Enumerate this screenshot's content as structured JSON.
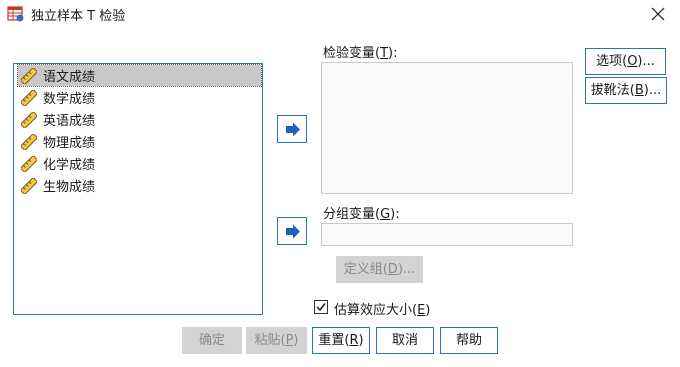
{
  "window": {
    "title": "独立样本 T 检验",
    "icons": {
      "app": "spss-dialog-icon",
      "close": "close-icon"
    }
  },
  "variables": [
    {
      "label": "语文成绩",
      "icon": "scale-ruler-icon",
      "selected": true
    },
    {
      "label": "数学成绩",
      "icon": "scale-ruler-icon",
      "selected": false
    },
    {
      "label": "英语成绩",
      "icon": "scale-ruler-icon",
      "selected": false
    },
    {
      "label": "物理成绩",
      "icon": "scale-ruler-icon",
      "selected": false
    },
    {
      "label": "化学成绩",
      "icon": "scale-ruler-icon",
      "selected": false
    },
    {
      "label": "生物成绩",
      "icon": "scale-ruler-icon",
      "selected": false
    }
  ],
  "test_variables": {
    "label": "检验变量(",
    "mnemonic": "T",
    "suffix": "):"
  },
  "grouping_variable": {
    "label": "分组变量(",
    "mnemonic": "G",
    "suffix": "):",
    "value": ""
  },
  "buttons": {
    "options": {
      "label": "选项(",
      "mnemonic": "O",
      "suffix": ")..."
    },
    "bootstrap": {
      "label": "拔靴法(",
      "mnemonic": "B",
      "suffix": ")..."
    },
    "define_groups": {
      "label": "定义组(",
      "mnemonic": "D",
      "suffix": ")..."
    },
    "ok": "确定",
    "paste": {
      "label": "粘贴(",
      "mnemonic": "P",
      "suffix": ")"
    },
    "reset": {
      "label": "重置(",
      "mnemonic": "R",
      "suffix": ")"
    },
    "cancel": "取消",
    "help": "帮助"
  },
  "effect_size": {
    "label": "估算效应大小(",
    "mnemonic": "E",
    "suffix": ")",
    "checked": true
  },
  "colors": {
    "accent": "#2f6fc6",
    "disabled_bg": "#d3d3d3",
    "selection": "#c8c8c8"
  }
}
